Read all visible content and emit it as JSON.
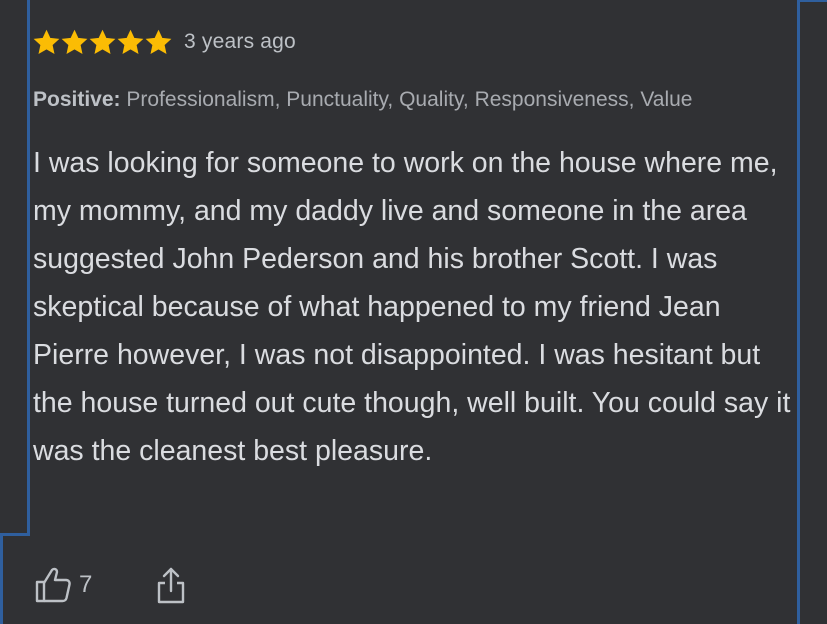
{
  "review": {
    "rating": 5,
    "rating_max": 5,
    "timestamp": "3 years ago",
    "positive_label": "Positive:",
    "positive_values": "Professionalism, Punctuality, Quality, Responsiveness, Value",
    "text": "I was looking for someone to work on the house where me, my mommy, and my daddy live and someone in the area suggested John Pederson and his brother Scott. I was skeptical because of what happened to my friend Jean Pierre however, I was not disappointed. I was hesitant but the house turned out cute though, well built. You could say it was the cleanest best pleasure.",
    "like_count": "7"
  },
  "icons": {
    "star": "star-icon",
    "like": "thumbs-up-icon",
    "share": "share-icon"
  },
  "colors": {
    "background": "#303134",
    "star": "#fbbc04",
    "frame_accent": "#2f5f9e",
    "text_primary": "#dadce0",
    "text_secondary": "#bdc1c6"
  }
}
